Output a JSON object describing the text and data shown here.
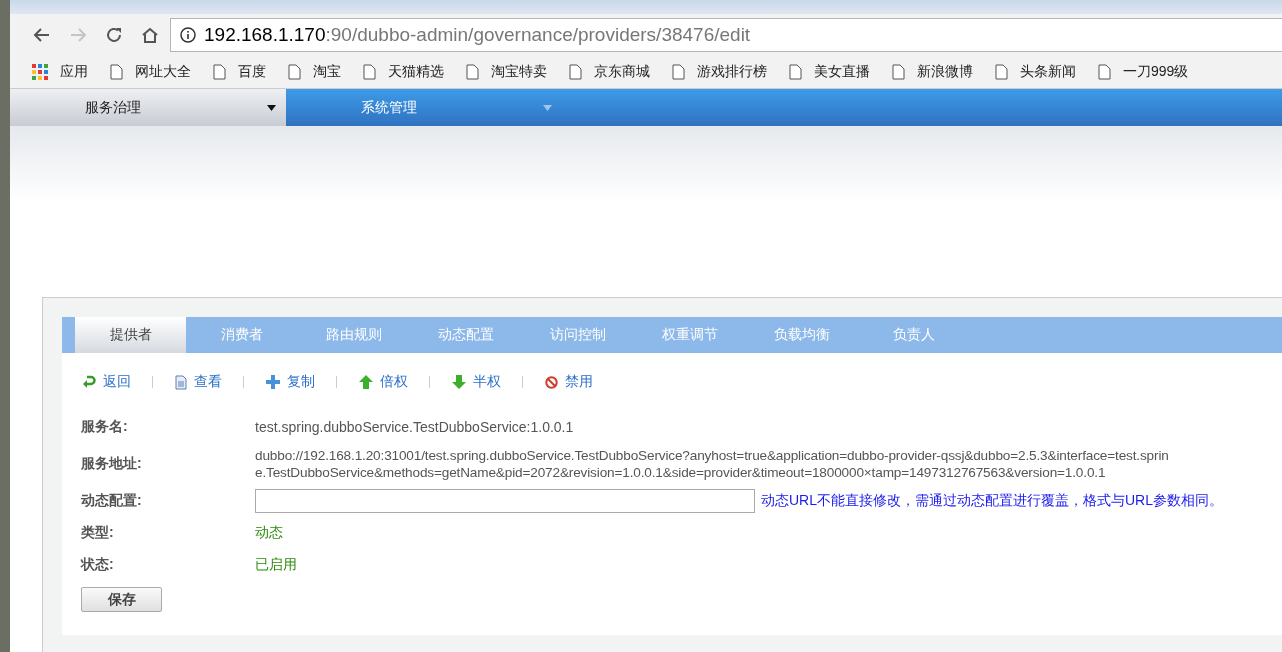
{
  "browser": {
    "back_enabled": true,
    "forward_enabled": false,
    "url_host": "192.168.1.170",
    "url_path": ":90/dubbo-admin/governance/providers/38476/edit",
    "bookmarks": [
      {
        "label": "应用",
        "kind": "apps"
      },
      {
        "label": "网址大全",
        "kind": "page"
      },
      {
        "label": "百度",
        "kind": "page"
      },
      {
        "label": "淘宝",
        "kind": "page"
      },
      {
        "label": "天猫精选",
        "kind": "page"
      },
      {
        "label": "淘宝特卖",
        "kind": "page"
      },
      {
        "label": "京东商城",
        "kind": "page"
      },
      {
        "label": "游戏排行榜",
        "kind": "page"
      },
      {
        "label": "美女直播",
        "kind": "page"
      },
      {
        "label": "新浪微博",
        "kind": "page"
      },
      {
        "label": "头条新闻",
        "kind": "page"
      },
      {
        "label": "一刀999级",
        "kind": "page"
      }
    ]
  },
  "top_menu": [
    {
      "label": "服务治理",
      "selected": true
    },
    {
      "label": "系统管理",
      "selected": false
    }
  ],
  "tabs": [
    {
      "label": "提供者",
      "selected": true
    },
    {
      "label": "消费者",
      "selected": false
    },
    {
      "label": "路由规则",
      "selected": false
    },
    {
      "label": "动态配置",
      "selected": false
    },
    {
      "label": "访问控制",
      "selected": false
    },
    {
      "label": "权重调节",
      "selected": false
    },
    {
      "label": "负载均衡",
      "selected": false
    },
    {
      "label": "负责人",
      "selected": false
    }
  ],
  "actions": [
    {
      "label": "返回",
      "kind": "back"
    },
    {
      "label": "查看",
      "kind": "view"
    },
    {
      "label": "复制",
      "kind": "copy"
    },
    {
      "label": "倍权",
      "kind": "double"
    },
    {
      "label": "半权",
      "kind": "half"
    },
    {
      "label": "禁用",
      "kind": "disable"
    }
  ],
  "form": {
    "rows": [
      {
        "kind": "text",
        "label": "服务名:",
        "value": "test.spring.dubboService.TestDubboService:1.0.0.1"
      },
      {
        "kind": "lines",
        "label": "服务地址:",
        "lines": [
          "dubbo://192.168.1.20:31001/test.spring.dubboService.TestDubboService?anyhost=true&application=dubbo-provider-qssj&dubbo=2.5.3&interface=test.sprin",
          "e.TestDubboService&methods=getName&pid=2072&revision=1.0.0.1&side=provider&timeout=1800000×tamp=1497312767563&version=1.0.0.1"
        ]
      },
      {
        "kind": "input",
        "label": "动态配置:",
        "note": "动态URL不能直接修改，需通过动态配置进行覆盖，格式与URL参数相同。"
      },
      {
        "kind": "status",
        "label": "类型:",
        "value": "动态"
      },
      {
        "kind": "status",
        "label": "状态:",
        "value": "已启用"
      }
    ],
    "save_button": "保存"
  }
}
